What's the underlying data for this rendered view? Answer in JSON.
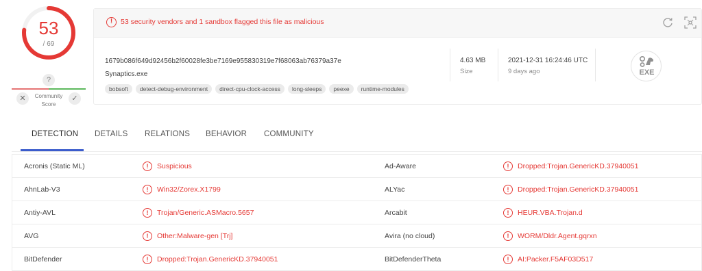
{
  "score": {
    "value": "53",
    "total": "/ 69",
    "detected": 53,
    "total_engines": 69,
    "color": "#e53935"
  },
  "community": {
    "question_mark": "?",
    "label_line1": "Community",
    "label_line2": "Score",
    "downvote_icon": "close-icon",
    "upvote_icon": "check-icon"
  },
  "alert": {
    "text": "53 security vendors and 1 sandbox flagged this file as malicious",
    "icon": "alert-circle-icon"
  },
  "file": {
    "hash": "1679b086f649d92456b2f60028fe3be7169e955830319e7f68063ab76379a37e",
    "name": "Synaptics.exe",
    "tags": [
      "bobsoft",
      "detect-debug-environment",
      "direct-cpu-clock-access",
      "long-sleeps",
      "peexe",
      "runtime-modules"
    ],
    "size_value": "4.63 MB",
    "size_label": "Size",
    "date_value": "2021-12-31 16:24:46 UTC",
    "date_label": "9 days ago",
    "type_label": "EXE"
  },
  "tabs": [
    "DETECTION",
    "DETAILS",
    "RELATIONS",
    "BEHAVIOR",
    "COMMUNITY"
  ],
  "active_tab": "DETECTION",
  "detections": [
    {
      "left_vendor": "Acronis (Static ML)",
      "left_result": "Suspicious",
      "right_vendor": "Ad-Aware",
      "right_result": "Dropped:Trojan.GenericKD.37940051"
    },
    {
      "left_vendor": "AhnLab-V3",
      "left_result": "Win32/Zorex.X1799",
      "right_vendor": "ALYac",
      "right_result": "Dropped:Trojan.GenericKD.37940051"
    },
    {
      "left_vendor": "Antiy-AVL",
      "left_result": "Trojan/Generic.ASMacro.5657",
      "right_vendor": "Arcabit",
      "right_result": "HEUR.VBA.Trojan.d"
    },
    {
      "left_vendor": "AVG",
      "left_result": "Other:Malware-gen [Trj]",
      "right_vendor": "Avira (no cloud)",
      "right_result": "WORM/Dldr.Agent.gqrxn"
    },
    {
      "left_vendor": "BitDefender",
      "left_result": "Dropped:Trojan.GenericKD.37940051",
      "right_vendor": "BitDefenderTheta",
      "right_result": "AI:Packer.F5AF03D517"
    }
  ],
  "colors": {
    "malicious": "#e53935",
    "accent": "#3b5ccc"
  }
}
